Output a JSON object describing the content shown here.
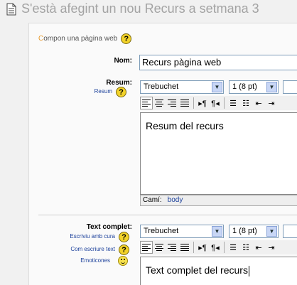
{
  "header": {
    "title": "S'està afegint un nou Recurs a setmana 3"
  },
  "form": {
    "legend_first": "C",
    "legend_rest": "ompon una pàgina web",
    "name": {
      "label": "Nom:",
      "value": "Recurs pàgina web"
    },
    "summary": {
      "label": "Resum:",
      "help_link": "Resum",
      "font_family": "Trebuchet",
      "font_size": "1 (8 pt)",
      "content": "Resum del recurs",
      "path_label": "Camí:",
      "path_value": "body"
    },
    "fulltext": {
      "label": "Text complet:",
      "links": [
        "Escriviu amb cura",
        "Com escriure text",
        "Emoticones"
      ],
      "font_family": "Trebuchet",
      "font_size": "1 (8 pt)",
      "content": "Text complet del recurs"
    }
  }
}
